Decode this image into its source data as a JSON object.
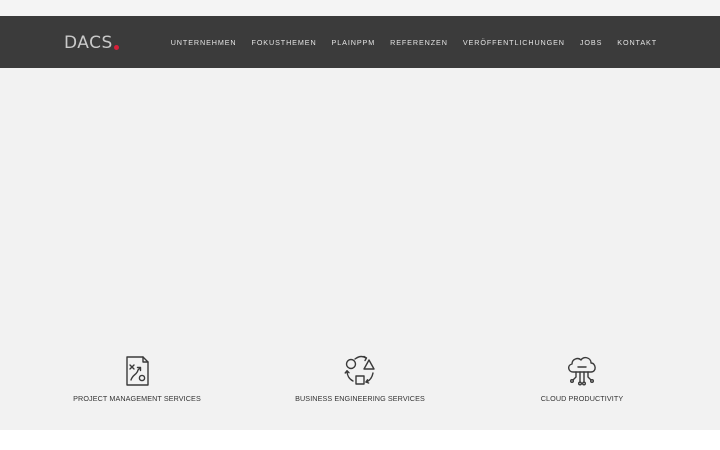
{
  "brand": {
    "logo_text": "DACS",
    "accent_color": "#d8203a"
  },
  "nav": {
    "items": [
      {
        "label": "UNTERNEHMEN"
      },
      {
        "label": "FOKUSTHEMEN"
      },
      {
        "label": "PLAINPPM"
      },
      {
        "label": "REFERENZEN"
      },
      {
        "label": "VERÖFFENTLICHUNGEN"
      },
      {
        "label": "JOBS"
      },
      {
        "label": "KONTAKT"
      }
    ]
  },
  "services": [
    {
      "label": "PROJECT MANAGEMENT SERVICES",
      "icon": "project-plan-icon"
    },
    {
      "label": "BUSINESS ENGINEERING SERVICES",
      "icon": "shapes-cycle-icon"
    },
    {
      "label": "CLOUD PRODUCTIVITY",
      "icon": "cloud-network-icon"
    }
  ]
}
